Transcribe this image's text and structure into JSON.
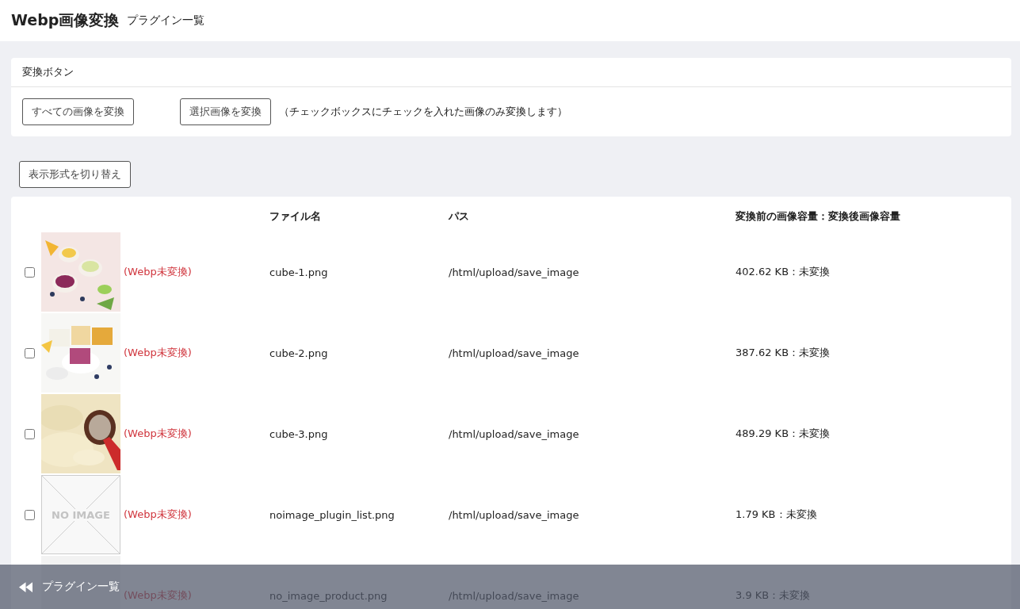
{
  "header": {
    "title": "Webp画像変換",
    "subtitle": "プラグイン一覧"
  },
  "convert_panel": {
    "heading": "変換ボタン",
    "buttons": [
      "すべての画像を変換",
      "選択画像を変換"
    ],
    "note": "（チェックボックスにチェックを入れた画像のみ変換します）"
  },
  "toggle_button": "表示形式を切り替え",
  "table": {
    "columns": [
      "ファイル名",
      "パス",
      "変換前の画像容量：変換後画像容量"
    ],
    "rows": [
      {
        "checked": false,
        "status": "(Webp未変換)",
        "file": "cube-1.png",
        "path": "/html/upload/save_image",
        "size": "402.62 KB：未変換"
      },
      {
        "checked": false,
        "status": "(Webp未変換)",
        "file": "cube-2.png",
        "path": "/html/upload/save_image",
        "size": "387.62 KB：未変換"
      },
      {
        "checked": false,
        "status": "(Webp未変換)",
        "file": "cube-3.png",
        "path": "/html/upload/save_image",
        "size": "489.29 KB：未変換"
      },
      {
        "checked": false,
        "thumbnail": {
          "kind": "placeholder",
          "text": "NO IMAGE"
        },
        "status": "(Webp未変換)",
        "file": "noimage_plugin_list.png",
        "path": "/html/upload/save_image",
        "size": "1.79 KB：未変換"
      },
      {
        "thumbnail": {
          "kind": "blank"
        },
        "status": "(Webp未変換)",
        "file": "no_image_product.png",
        "path": "/html/upload/save_image",
        "size": "3.9 KB：未変換"
      }
    ]
  },
  "bottom_bar": {
    "back_link": "プラグイン一覧"
  }
}
